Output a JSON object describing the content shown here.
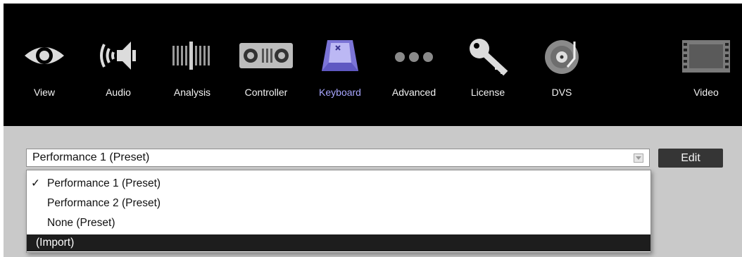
{
  "toolbar": {
    "tabs": [
      {
        "label": "View",
        "icon": "eye-icon"
      },
      {
        "label": "Audio",
        "icon": "speaker-icon"
      },
      {
        "label": "Analysis",
        "icon": "waveform-icon"
      },
      {
        "label": "Controller",
        "icon": "controller-icon"
      },
      {
        "label": "Keyboard",
        "icon": "keyboard-key-icon"
      },
      {
        "label": "Advanced",
        "icon": "three-dots-icon"
      },
      {
        "label": "License",
        "icon": "key-icon"
      },
      {
        "label": "DVS",
        "icon": "turntable-icon"
      },
      {
        "label": "Video",
        "icon": "film-icon"
      }
    ],
    "active_tab": "Keyboard"
  },
  "preset_select": {
    "value": "Performance 1 (Preset)",
    "edit_label": "Edit",
    "options": [
      {
        "label": "Performance 1 (Preset)",
        "checked": true
      },
      {
        "label": "Performance 2 (Preset)",
        "checked": false
      },
      {
        "label": "None (Preset)",
        "checked": false
      },
      {
        "label": "(Import)",
        "checked": false,
        "highlighted": true
      }
    ],
    "check_mark": "✓"
  },
  "colors": {
    "toolbar_bg": "#000000",
    "panel_bg": "#c9c9c9",
    "active_tab_text": "#a8a6ff",
    "highlight_bg": "#1d1d1d",
    "edit_button_bg": "#353535"
  }
}
